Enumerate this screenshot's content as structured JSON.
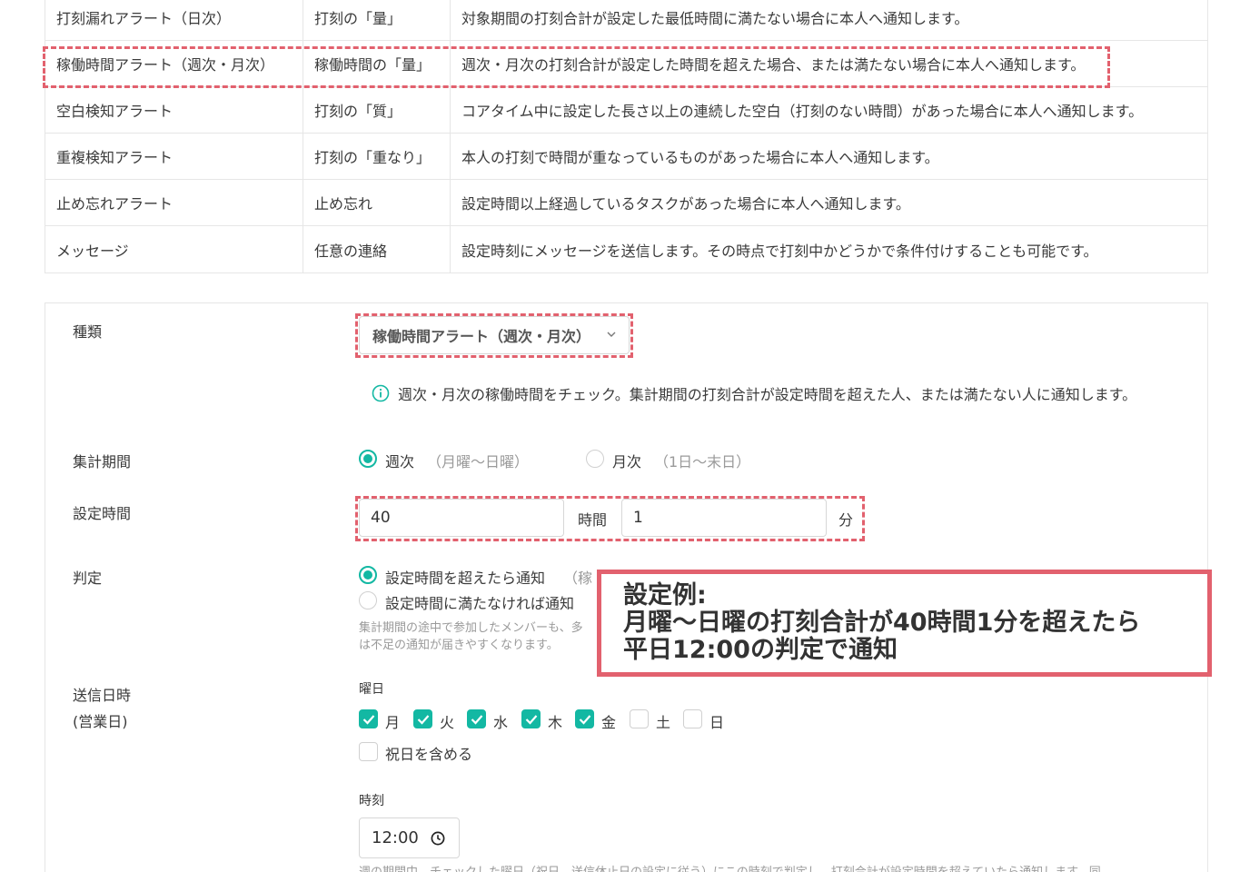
{
  "alert_table": {
    "rows": [
      {
        "name": "打刻漏れアラート（日次）",
        "target": "打刻の「量」",
        "desc": "対象期間の打刻合計が設定した最低時間に満たない場合に本人へ通知します。"
      },
      {
        "name": "稼働時間アラート（週次・月次）",
        "target": "稼働時間の「量」",
        "desc": "週次・月次の打刻合計が設定した時間を超えた場合、または満たない場合に本人へ通知します。"
      },
      {
        "name": "空白検知アラート",
        "target": "打刻の「質」",
        "desc": "コアタイム中に設定した長さ以上の連続した空白（打刻のない時間）があった場合に本人へ通知します。"
      },
      {
        "name": "重複検知アラート",
        "target": "打刻の「重なり」",
        "desc": "本人の打刻で時間が重なっているものがあった場合に本人へ通知します。"
      },
      {
        "name": "止め忘れアラート",
        "target": "止め忘れ",
        "desc": "設定時間以上経過しているタスクがあった場合に本人へ通知します。"
      },
      {
        "name": "メッセージ",
        "target": "任意の連絡",
        "desc": "設定時刻にメッセージを送信します。その時点で打刻中かどうかで条件付けすることも可能です。"
      }
    ]
  },
  "form": {
    "type_label": "種類",
    "type_value": "稼働時間アラート（週次・月次）",
    "type_info": "週次・月次の稼働時間をチェック。集計期間の打刻合計が設定時間を超えた人、または満たない人に通知します。",
    "period_label": "集計期間",
    "period_options": [
      {
        "label": "週次",
        "note": "（月曜〜日曜）",
        "selected": true
      },
      {
        "label": "月次",
        "note": "（1日〜末日）",
        "selected": false
      }
    ],
    "time_label": "設定時間",
    "hours_value": "40",
    "hours_unit": "時間",
    "minutes_value": "1",
    "minutes_unit": "分",
    "judge_label": "判定",
    "judge_options": [
      {
        "label": "設定時間を超えたら通知",
        "note": "（稼",
        "selected": true
      },
      {
        "label": "設定時間に満たなければ通知",
        "selected": false
      }
    ],
    "judge_note_1": "集計期間の途中で参加したメンバーも、多",
    "judge_note_2": "は不足の通知が届きやすくなります。",
    "send_label_1": "送信日時",
    "send_label_2": "(営業日)",
    "weekday_heading": "曜日",
    "weekdays": [
      {
        "label": "月",
        "checked": true
      },
      {
        "label": "火",
        "checked": true
      },
      {
        "label": "水",
        "checked": true
      },
      {
        "label": "木",
        "checked": true
      },
      {
        "label": "金",
        "checked": true
      },
      {
        "label": "土",
        "checked": false
      },
      {
        "label": "日",
        "checked": false
      }
    ],
    "holiday_label": "祝日を含める",
    "holiday_checked": false,
    "time_heading": "時刻",
    "send_time": "12:00",
    "bottom_note": "週の期間中、チェックした曜日（祝日、送信休止日の設定に従う）にこの時刻で判定し、打刻合計が設定時間を超えていたら通知します。同"
  },
  "callout": {
    "line1": "設定例:",
    "line2": "月曜〜日曜の打刻合計が40時間1分を超えたら",
    "line3": "平日12:00の判定で通知"
  },
  "colors": {
    "accent": "#13b8a3",
    "highlight": "#e2616e",
    "border": "#e6e6e6"
  }
}
